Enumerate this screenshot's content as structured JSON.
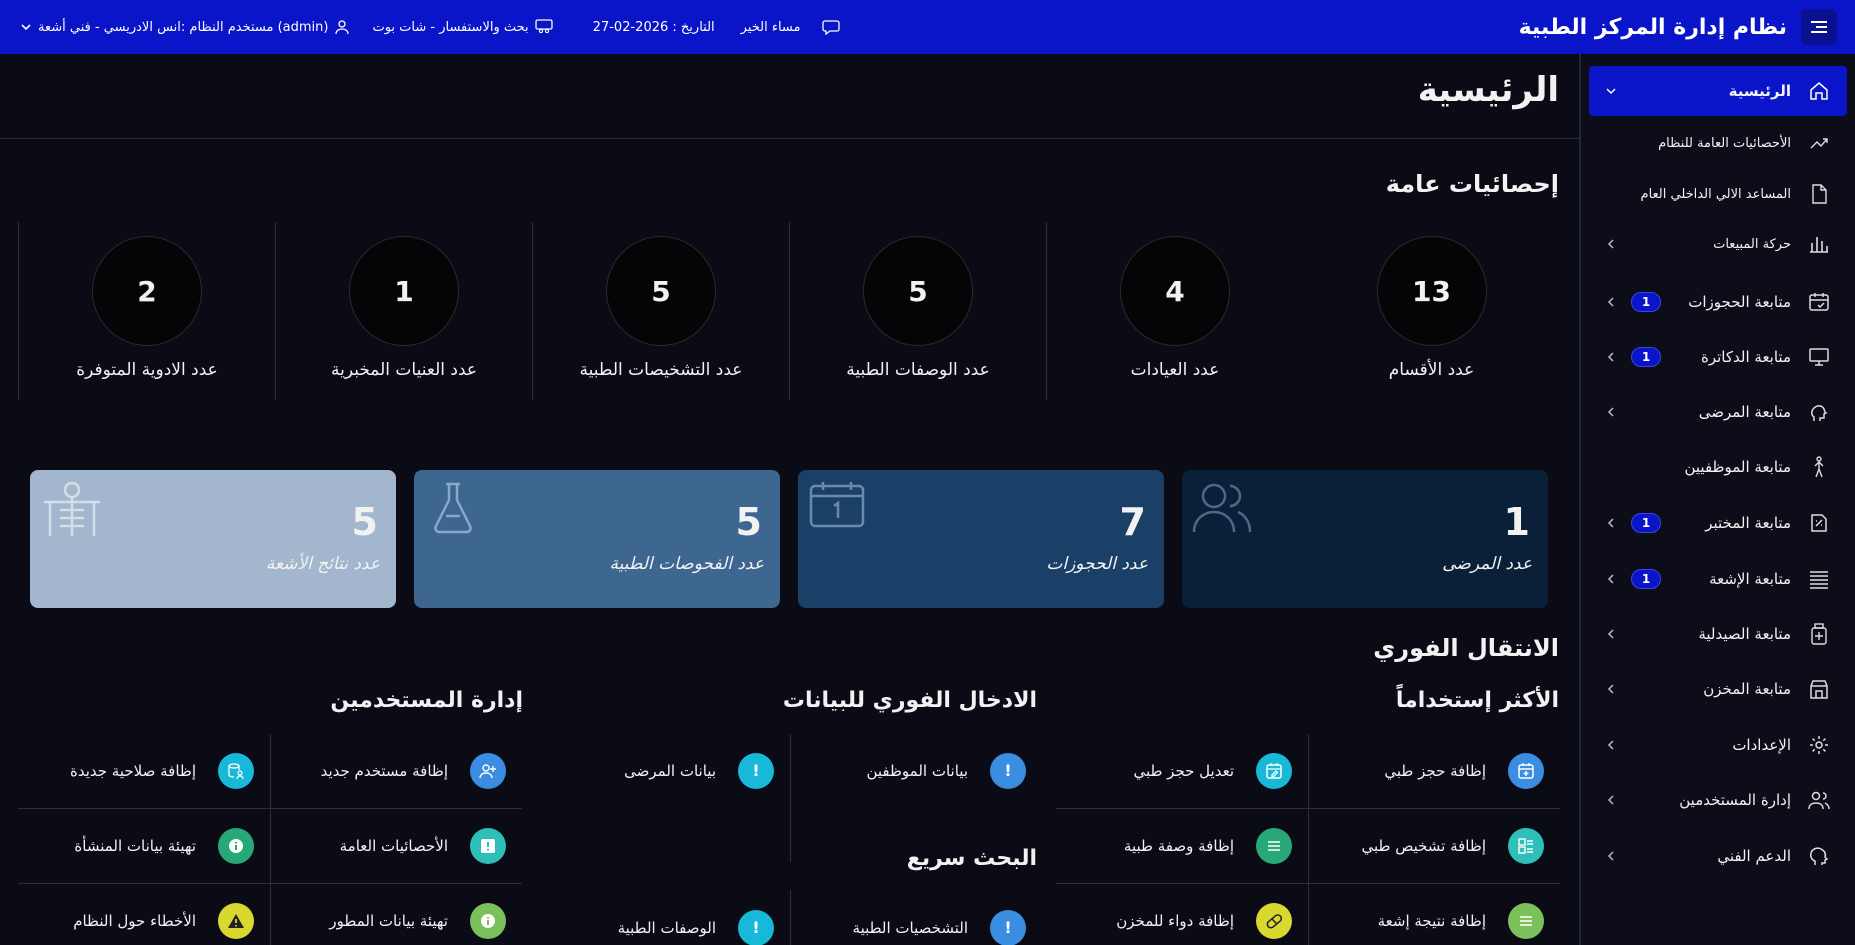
{
  "header": {
    "app_title": "نظام إدارة المركز الطبية",
    "greeting": "مساء الخير",
    "date_text": "التاريخ : 2026-02-27",
    "chatbot_text": "بحث والاستفسار - شات بوت",
    "user_text": "مستخدم النظام :انس الادريسي - فني أشعة (admin)"
  },
  "sidebar": {
    "items": [
      {
        "label": "الرئيسية"
      },
      {
        "label": "الأحصائيات العامة للنظام"
      },
      {
        "label": "المساعد الالي الداخلي العام"
      },
      {
        "label": "حركة المبيعات"
      },
      {
        "label": "متابعة الحجوزات",
        "badge": "1"
      },
      {
        "label": "متابعة الدكاترة",
        "badge": "1"
      },
      {
        "label": "متابعة المرضى"
      },
      {
        "label": "متابعة الموظفيين"
      },
      {
        "label": "متابعة المختبر",
        "badge": "1"
      },
      {
        "label": "متابعة الإشعة",
        "badge": "1"
      },
      {
        "label": "متابعة الصيدلية"
      },
      {
        "label": "متابعة المخزن"
      },
      {
        "label": "الإعدادات"
      },
      {
        "label": "إدارة المستخدمين"
      },
      {
        "label": "الدعم الفني"
      }
    ]
  },
  "main": {
    "page_title": "الرئيسية",
    "general_stats_title": "إحصائيات عامة",
    "stats": [
      {
        "value": "13",
        "label": "عدد الأقسام"
      },
      {
        "value": "4",
        "label": "عدد العيادات"
      },
      {
        "value": "5",
        "label": "عدد الوصفات الطبية"
      },
      {
        "value": "5",
        "label": "عدد التشخيصات الطبية"
      },
      {
        "value": "1",
        "label": "عدد العنيات المخبرية"
      },
      {
        "value": "2",
        "label": "عدد الادوية المتوفرة"
      }
    ],
    "cards": [
      {
        "value": "1",
        "label": "عدد المرضى",
        "color": "#0a2038"
      },
      {
        "value": "7",
        "label": "عدد الحجوزات",
        "color": "#1b4068"
      },
      {
        "value": "5",
        "label": "عدد الفحوصات الطبية",
        "color": "#3d6790"
      },
      {
        "value": "5",
        "label": "عدد نتائج الأشعة",
        "color": "#a2b6cd"
      }
    ],
    "quick_title": "الانتقال الفوري",
    "most_used_title": "الأكثر إستخداماً",
    "data_entry_title": "الادخال الفوري للبيانات",
    "users_mgmt_title": "إدارة المستخدمين",
    "quick_search_title": "البحث سريع",
    "most_used": [
      {
        "label": "إظافة حجز طبي",
        "color": "#3a8de0",
        "icon": "calendar-plus-icon"
      },
      {
        "label": "تعديل حجز طبي",
        "color": "#17b8d8",
        "icon": "calendar-edit-icon"
      },
      {
        "label": "إظافة تشخيص طبي",
        "color": "#2ec0b8",
        "icon": "diagnosis-icon"
      },
      {
        "label": "إظافة وصفة طبية",
        "color": "#28a878",
        "icon": "list-icon"
      },
      {
        "label": "إظافة نتيجة إشعة",
        "color": "#7bc05a",
        "icon": "list-icon"
      },
      {
        "label": "إظافة دواء للمخزن",
        "color": "#d8d830",
        "icon": "pill-icon"
      }
    ],
    "data_entry": [
      {
        "label": "بيانات الموظفين",
        "color": "#3a8de0"
      },
      {
        "label": "بيانات المرضى",
        "color": "#17b8d8"
      }
    ],
    "quick_search": [
      {
        "label": "التشخصيات الطبية",
        "color": "#3a8de0"
      },
      {
        "label": "الوصفات الطبية",
        "color": "#17b8d8"
      }
    ],
    "users_mgmt": [
      {
        "label": "إظافة مستخدم جديد",
        "color": "#3a8de0",
        "icon": "user-plus-icon"
      },
      {
        "label": "إظافة صلاحية جديدة",
        "color": "#17b8d8",
        "icon": "database-user-icon"
      },
      {
        "label": "الأحصائيات العامة",
        "color": "#2ec0b8",
        "icon": "alert-box-icon"
      },
      {
        "label": "تهيئة بيانات المنشأة",
        "color": "#28a878",
        "icon": "info-icon"
      },
      {
        "label": "تهيئة بيانات المطور",
        "color": "#7bc05a",
        "icon": "info-icon"
      },
      {
        "label": "الأخطاء حول النظام",
        "color": "#d8d830",
        "icon": "warning-icon"
      }
    ]
  }
}
